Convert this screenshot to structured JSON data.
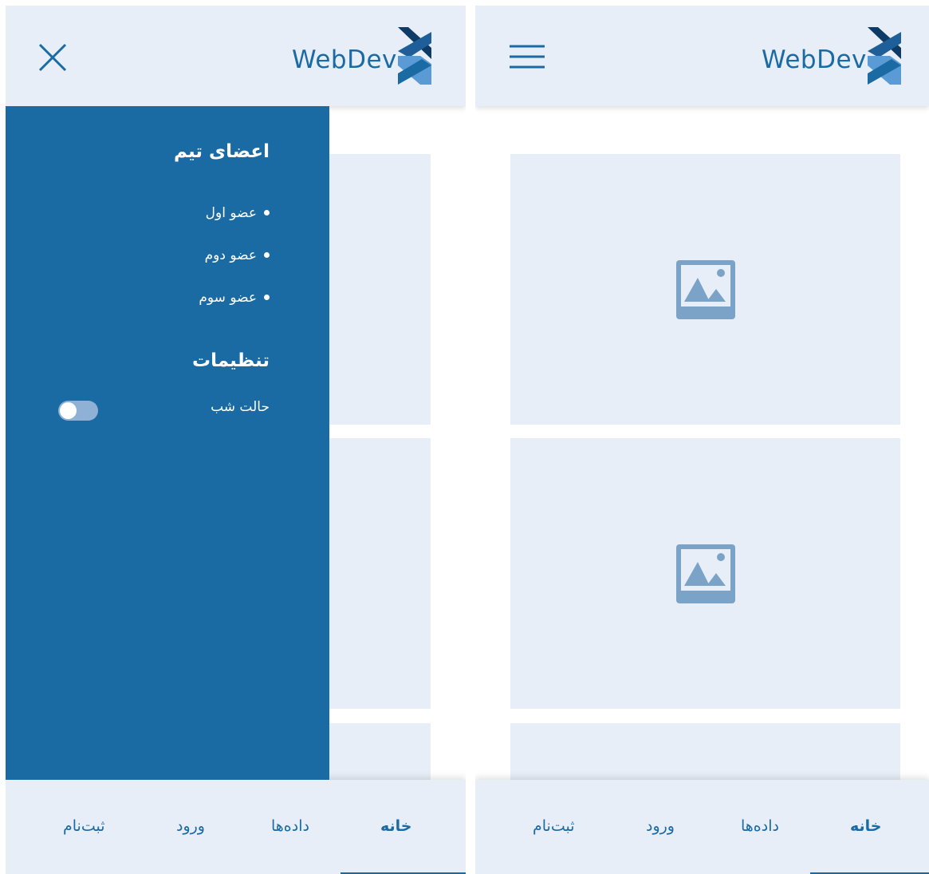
{
  "brand": {
    "name": "WebDev"
  },
  "colors": {
    "primary": "#1a6aa3",
    "surface": "#e8eef7",
    "placeholder": "#7ba3c8",
    "toggle_track": "#8fb1d6"
  },
  "icons": {
    "menu": "hamburger-icon",
    "close": "close-icon",
    "image": "image-placeholder-icon",
    "logo": "webdev-logo"
  },
  "nav": {
    "items": [
      {
        "label": "خانه",
        "active": true
      },
      {
        "label": "داده‌ها",
        "active": false
      },
      {
        "label": "ورود",
        "active": false
      },
      {
        "label": "ثبت‌نام",
        "active": false
      }
    ]
  },
  "drawer": {
    "team_heading": "اعضای تیم",
    "members": [
      "عضو اول",
      "عضو دوم",
      "عضو سوم"
    ],
    "settings_heading": "تنظیمات",
    "night_mode_label": "حالت شب",
    "night_mode_on": false
  }
}
